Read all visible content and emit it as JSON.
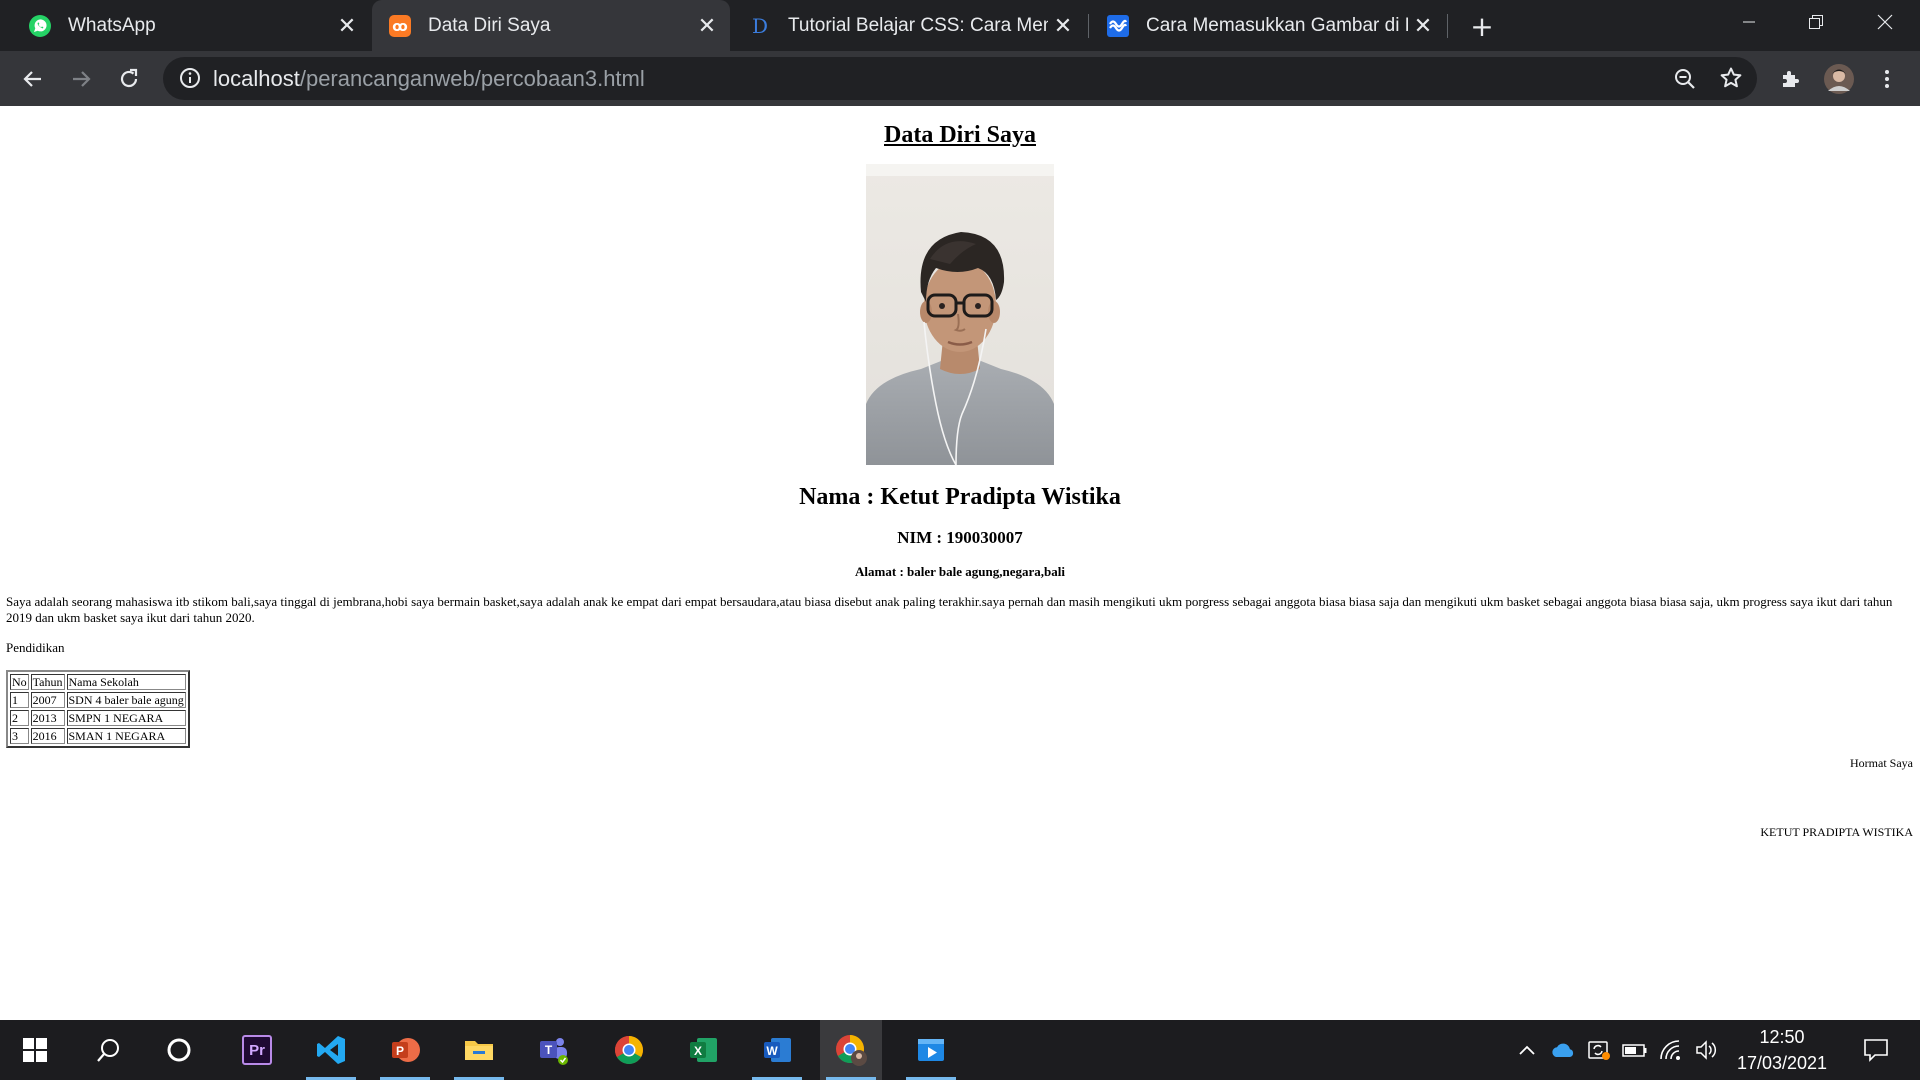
{
  "browser": {
    "tabs": [
      {
        "title": "WhatsApp",
        "icon": "whatsapp-icon",
        "active": false
      },
      {
        "title": "Data Diri Saya",
        "icon": "xampp-icon",
        "active": true
      },
      {
        "title": "Tutorial Belajar CSS: Cara Menga",
        "icon": "duniailkom-icon",
        "active": false
      },
      {
        "title": "Cara Memasukkan Gambar di HT",
        "icon": "codepolitan-icon",
        "active": false
      }
    ],
    "address": {
      "host": "localhost",
      "path": "/perancanganweb/percobaan3.html"
    }
  },
  "page": {
    "title": "Data Diri Saya",
    "photo": "profile-photo",
    "nama": "Nama : Ketut Pradipta Wistika",
    "nim": "NIM : 190030007",
    "alamat": "Alamat : baler bale agung,negara,bali",
    "bio": "Saya adalah seorang mahasiswa itb stikom bali,saya tinggal di jembrana,hobi saya bermain basket,saya adalah anak ke empat dari empat bersaudara,atau biasa disebut anak paling terakhir.saya pernah dan masih mengikuti ukm porgress sebagai anggota biasa biasa saja dan mengikuti ukm basket sebagai anggota biasa biasa saja, ukm progress saya ikut dari tahun 2019 dan ukm basket saya ikut dari tahun 2020.",
    "pendidikan_label": "Pendidikan",
    "table": {
      "headers": [
        "No",
        "Tahun",
        "Nama Sekolah"
      ],
      "rows": [
        [
          "1",
          "2007",
          "SDN 4 baler bale agung"
        ],
        [
          "2",
          "2013",
          "SMPN 1 NEGARA"
        ],
        [
          "3",
          "2016",
          "SMAN 1 NEGARA"
        ]
      ]
    },
    "closing": "Hormat Saya",
    "signature_name": "KETUT PRADIPTA WISTIKA"
  },
  "taskbar": {
    "apps": [
      "windows-start",
      "search",
      "cortana",
      "premiere-pro",
      "vscode",
      "powerpoint",
      "file-explorer",
      "teams",
      "chrome",
      "excel",
      "word",
      "chrome-profile",
      "media-player"
    ],
    "clock": {
      "time": "12:50",
      "date": "17/03/2021"
    }
  },
  "colors": {
    "tabstrip": "#202124",
    "toolbar": "#35363a",
    "taskbar": "#1c1c1f",
    "accent": "#76b9ed"
  }
}
